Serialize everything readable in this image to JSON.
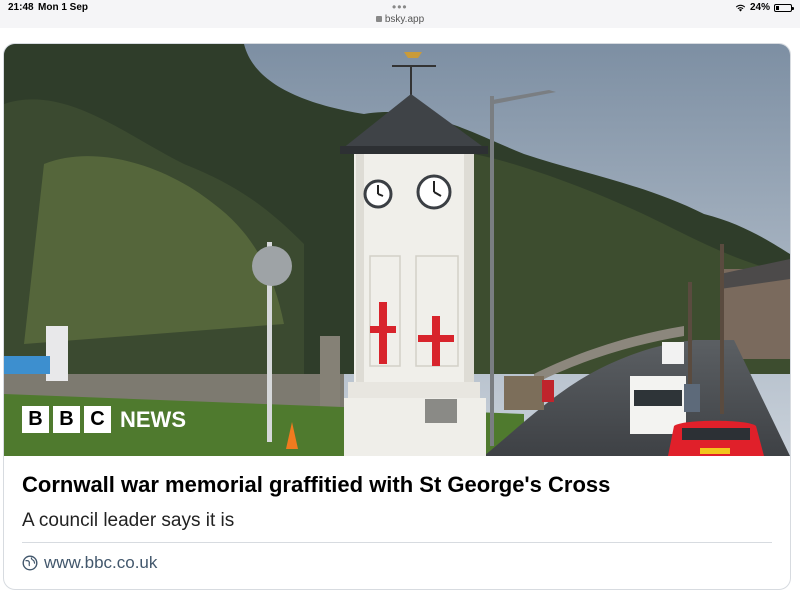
{
  "status_bar": {
    "time": "21:48",
    "date": "Mon 1 Sep",
    "url": "bsky.app",
    "battery_percent_label": "24%",
    "battery_level": 0.24
  },
  "card": {
    "image": {
      "description_icon": "photo",
      "logo": {
        "letters": [
          "B",
          "B",
          "C"
        ],
        "news_label": "NEWS"
      }
    },
    "headline": "Cornwall war memorial graffitied with St George's Cross",
    "description": "A council leader says it is",
    "domain": "www.bbc.co.uk",
    "domain_icon": "globe-icon"
  },
  "colors": {
    "cross_red": "#d8242c",
    "link_gray": "#42576c",
    "border": "#d7dbe0"
  }
}
